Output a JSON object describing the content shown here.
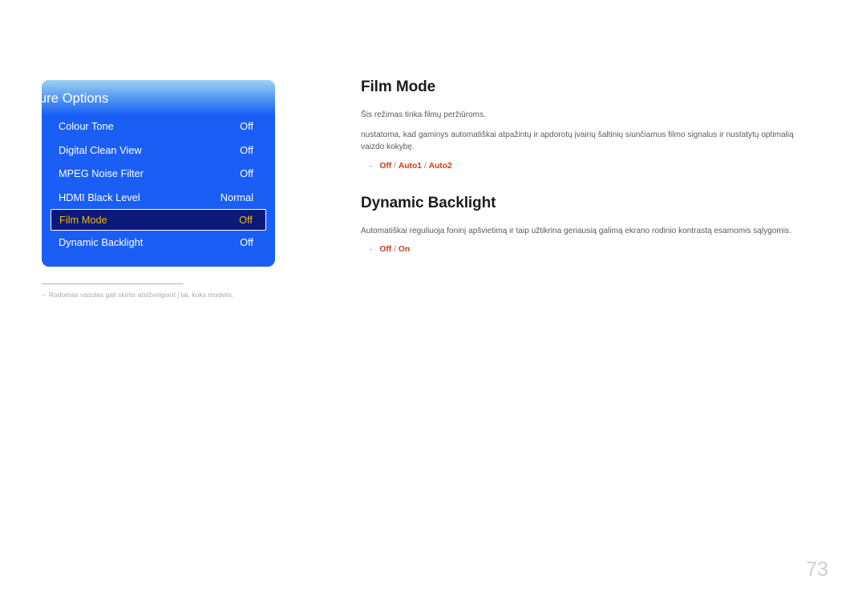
{
  "osd": {
    "title": "Picture Options",
    "rows": [
      {
        "label": "Colour Tone",
        "value": "Off",
        "selected": false
      },
      {
        "label": "Digital Clean View",
        "value": "Off",
        "selected": false
      },
      {
        "label": "MPEG Noise Filter",
        "value": "Off",
        "selected": false
      },
      {
        "label": "HDMI Black Level",
        "value": "Normal",
        "selected": false
      },
      {
        "label": "Film Mode",
        "value": "Off",
        "selected": true
      },
      {
        "label": "Dynamic Backlight",
        "value": "Off",
        "selected": false
      }
    ],
    "colors": {
      "panel_blue": "#1a5ef5",
      "header_light": "#9fd2f2",
      "selected_bg": "#0b1978",
      "selected_text": "#f5b519"
    }
  },
  "footnote": {
    "dash": "–",
    "text": "Rodomas vaizdas gali skirtis atsižvelgiant į tai, koks modelis."
  },
  "sections": [
    {
      "heading": "Film Mode",
      "paragraphs": [
        "Šis režimas tinka filmų peržiūroms.",
        "nustatoma, kad gaminys automatiškai atpažintų ir apdorotų įvairių šaltinių siunčiamus filmo signalus ir nustatytų optimalią vaizdo kokybę."
      ],
      "bullet": "·",
      "options": [
        "Off",
        "Auto1",
        "Auto2"
      ],
      "options_separator": " / "
    },
    {
      "heading": "Dynamic Backlight",
      "paragraphs": [
        "Automatiškai reguliuoja foninį apšvietimą ir taip užtikrina geriausią galimą ekrano rodinio kontrastą esamomis sąlygomis."
      ],
      "bullet": "·",
      "options": [
        "Off",
        "On"
      ],
      "options_separator": " / "
    }
  ],
  "page_number": "73"
}
